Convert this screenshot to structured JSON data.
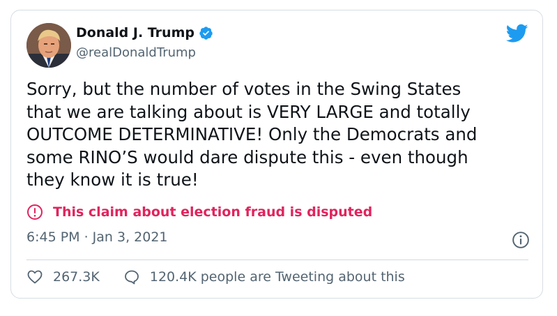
{
  "tweet": {
    "author_name": "Donald J. Trump",
    "handle": "@realDonaldTrump",
    "text": "Sorry, but the number of votes in the Swing States\nthat we are talking about is VERY LARGE and totally\nOUTCOME DETERMINATIVE! Only the Democrats and\nsome RINO’S would dare dispute this - even though\nthey know it is true!",
    "dispute_label": "This claim about election fraud is disputed",
    "timestamp": "6:45 PM · Jan 3, 2021",
    "likes": "267.3K",
    "tweeting_about": "120.4K people are Tweeting about this"
  },
  "icons": {
    "verified": "verified-badge-icon",
    "brand": "twitter-bird-icon",
    "dispute": "exclamation-circle-icon",
    "info": "info-icon",
    "like": "heart-icon",
    "reply": "speech-bubble-icon"
  },
  "colors": {
    "brand_blue": "#1d9bf0",
    "dispute_red": "#e0245e",
    "text": "#0f1419",
    "secondary": "#536471",
    "border": "#d6dde3"
  }
}
